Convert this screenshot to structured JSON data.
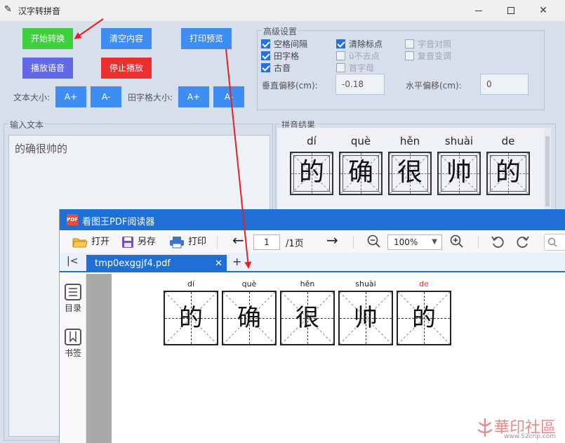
{
  "app": {
    "title": "汉字转拼音",
    "buttons": {
      "start": "开始转换",
      "clear": "清空内容",
      "print_preview": "打印预览",
      "play": "播放语音",
      "stop": "停止播放"
    },
    "text_size_label": "文本大小:",
    "grid_size_label": "田字格大小:",
    "inc": "A+",
    "dec": "A-",
    "advanced": {
      "title": "高级设置",
      "options": [
        {
          "label": "空格间隔",
          "checked": true,
          "enabled": true
        },
        {
          "label": "清除标点",
          "checked": true,
          "enabled": true
        },
        {
          "label": "字音对照",
          "checked": false,
          "enabled": false
        },
        {
          "label": "田字格",
          "checked": true,
          "enabled": true
        },
        {
          "label": "ü不去点",
          "checked": false,
          "enabled": false
        },
        {
          "label": "复音变调",
          "checked": false,
          "enabled": false
        },
        {
          "label": "古音",
          "checked": true,
          "enabled": true
        },
        {
          "label": "首字母",
          "checked": false,
          "enabled": false
        }
      ],
      "vertical_offset_label": "垂直偏移(cm):",
      "vertical_offset_value": "-0.18",
      "horizontal_offset_label": "水平偏移(cm):",
      "horizontal_offset_value": "0"
    },
    "input_group_title": "输入文本",
    "input_text": "的确很帅的",
    "result_group_title": "拼音结果",
    "results": [
      {
        "pinyin": "dí",
        "hanzi": "的"
      },
      {
        "pinyin": "què",
        "hanzi": "确"
      },
      {
        "pinyin": "hěn",
        "hanzi": "很"
      },
      {
        "pinyin": "shuài",
        "hanzi": "帅"
      },
      {
        "pinyin": "de",
        "hanzi": "的"
      }
    ]
  },
  "pdf": {
    "title": "看图王PDF阅读器",
    "logo_text": "PDF",
    "toolbar": {
      "open": "打开",
      "save_as": "另存",
      "print": "打印",
      "page_value": "1",
      "page_total": "/1页",
      "zoom": "100%"
    },
    "tab_name": "tmp0exggjf4.pdf",
    "sidebar": {
      "toc": "目录",
      "bookmark": "书签"
    },
    "cells": [
      {
        "pinyin": "dí",
        "hanzi": "的",
        "highlight": false
      },
      {
        "pinyin": "què",
        "hanzi": "确",
        "highlight": false
      },
      {
        "pinyin": "hěn",
        "hanzi": "很",
        "highlight": false
      },
      {
        "pinyin": "shuài",
        "hanzi": "帅",
        "highlight": false
      },
      {
        "pinyin": "de",
        "hanzi": "的",
        "highlight": true
      }
    ],
    "highlight_color": "#e03a2c"
  },
  "watermark": {
    "text": "華印社區",
    "url": "www.52cnp.com"
  },
  "colors": {
    "green": "#3fcf3f",
    "blue": "#3d8df2",
    "purple": "#6269e6",
    "red": "#ec2f2f",
    "pdf_blue": "#1f6fd6",
    "arrow": "#e8211e"
  }
}
